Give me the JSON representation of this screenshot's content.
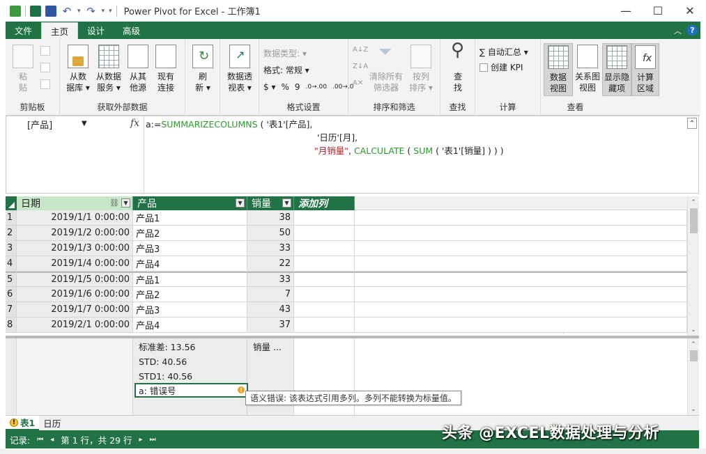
{
  "window": {
    "title": "Power Pivot for Excel - 工作簿1",
    "minimize": "—",
    "maximize": "☐",
    "close": "✕"
  },
  "tabs": [
    {
      "label": "文件",
      "active": false
    },
    {
      "label": "主页",
      "active": true
    },
    {
      "label": "设计",
      "active": false
    },
    {
      "label": "高级",
      "active": false
    }
  ],
  "ribbon": {
    "clipboard": {
      "paste": "粘\n贴",
      "label": "剪贴板"
    },
    "external": {
      "from_db": "从数\n据库 ▾",
      "from_service": "从数据\n服务 ▾",
      "from_other": "从其\n他源",
      "existing": "现有\n连接",
      "label": "获取外部数据"
    },
    "refresh": {
      "text": "刷\n新 ▾"
    },
    "pivot": {
      "text": "数据透\n视表 ▾"
    },
    "format": {
      "data_type": "数据类型:",
      "format": "格式: 常规 ▾",
      "currency": "$ ▾",
      "percent": "%",
      "comma": "9",
      "inc_dec": ".0→.00",
      "dec_dec": ".00→.0",
      "label": "格式设置"
    },
    "sort": {
      "clear_filters": "清除所有\n筛选器",
      "sort_by": "按列\n排序 ▾",
      "label": "排序和筛选"
    },
    "find": {
      "text": "查\n找",
      "label": "查找"
    },
    "calc": {
      "autosum": "∑ 自动汇总 ▾",
      "kpi": "创建 KPI",
      "label": "计算"
    },
    "view": {
      "data_view": "数据\n视图",
      "diagram_view": "关系图\n视图",
      "show_hidden": "显示隐\n藏项",
      "calc_area": "计算\n区域",
      "label": "查看"
    }
  },
  "formula": {
    "namebox": "[产品]",
    "fx": "fx",
    "line1_prefix": "a:=",
    "line1_fn": "SUMMARIZECOLUMNS",
    "line1_rest": " ( '表1'[产品],",
    "line2": "'日历'[月],",
    "line3_str": "\"月销量\"",
    "line3_sep": ", ",
    "line3_fn1": "CALCULATE",
    "line3_mid": " ( ",
    "line3_fn2": "SUM",
    "line3_rest": " ( '表1'[销量] ) ) )"
  },
  "table": {
    "columns": [
      "日期",
      "产品",
      "销量",
      "添加列"
    ],
    "rows": [
      {
        "n": "1",
        "date": "2019/1/1 0:00:00",
        "product": "产品1",
        "sales": "38"
      },
      {
        "n": "2",
        "date": "2019/1/2 0:00:00",
        "product": "产品2",
        "sales": "50"
      },
      {
        "n": "3",
        "date": "2019/1/3 0:00:00",
        "product": "产品3",
        "sales": "33"
      },
      {
        "n": "4",
        "date": "2019/1/4 0:00:00",
        "product": "产品4",
        "sales": "22"
      },
      {
        "n": "5",
        "date": "2019/1/5 0:00:00",
        "product": "产品1",
        "sales": "33"
      },
      {
        "n": "6",
        "date": "2019/1/6 0:00:00",
        "product": "产品2",
        "sales": "7"
      },
      {
        "n": "7",
        "date": "2019/1/7 0:00:00",
        "product": "产品3",
        "sales": "43"
      },
      {
        "n": "8",
        "date": "2019/2/1 0:00:00",
        "product": "产品4",
        "sales": "37"
      }
    ]
  },
  "calc_area": {
    "stddev": "标准差: 13.56",
    "sales_measure": "销量 ...",
    "std": "STD: 40.56",
    "std1": "STD1: 40.56",
    "a_error": "a: 错误号",
    "error_icon": "!",
    "tooltip": "语义错误: 该表达式引用多列。多列不能转换为标量值。"
  },
  "sheets": [
    {
      "label": "表1",
      "active": true,
      "warning": "!"
    },
    {
      "label": "日历",
      "active": false
    }
  ],
  "status": {
    "record_label": "记录:",
    "first": "⏮",
    "prev": "◂",
    "position": "第 1 行，共 29 行",
    "next": "▸",
    "last": "⏭"
  },
  "watermark": "头条 @EXCEL数据处理与分析",
  "colors": {
    "accent": "#217346",
    "error": "#b5232a",
    "function": "#2a9a2a"
  }
}
